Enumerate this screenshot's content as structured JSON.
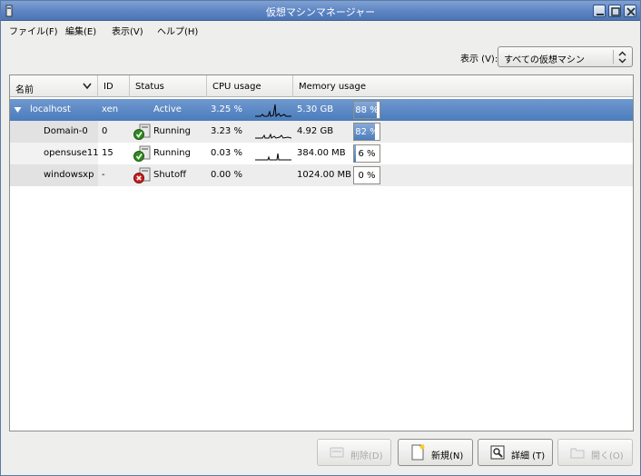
{
  "window": {
    "title": "仮想マシンマネージャー"
  },
  "menu": [
    "ファイル(F)",
    "編集(E)",
    "表示(V)",
    "ヘルプ(H)"
  ],
  "view_filter": {
    "label": "表示 (V):",
    "value": "すべての仮想マシン"
  },
  "columns": {
    "name": "名前",
    "id": "ID",
    "status": "Status",
    "cpu": "CPU usage",
    "memory": "Memory usage"
  },
  "rows": [
    {
      "name": "localhost",
      "id": "xen",
      "status": "Active",
      "cpu": "3.25 %",
      "memory": "5.30 GB",
      "mem_pct": "88 %",
      "mem_fraction": 0.88,
      "status_icon": "none"
    },
    {
      "name": "Domain-0",
      "id": "0",
      "status": "Running",
      "cpu": "3.23 %",
      "memory": "4.92 GB",
      "mem_pct": "82 %",
      "mem_fraction": 0.82,
      "status_icon": "running-icon"
    },
    {
      "name": "opensuse11",
      "id": "15",
      "status": "Running",
      "cpu": "0.03 %",
      "memory": "384.00 MB",
      "mem_pct": "6 %",
      "mem_fraction": 0.06,
      "status_icon": "running-icon"
    },
    {
      "name": "windowsxp",
      "id": "-",
      "status": "Shutoff",
      "cpu": "0.00 %",
      "memory": "1024.00 MB",
      "mem_pct": "0 %",
      "mem_fraction": 0.0,
      "status_icon": "shutoff-icon"
    }
  ],
  "buttons": {
    "delete": "削除(D)",
    "new": "新規(N)",
    "details": "詳細 (T)",
    "open": "開く(O)"
  },
  "colors": {
    "selection": "#4b7cbc",
    "titlebar": "#5d84c3"
  }
}
